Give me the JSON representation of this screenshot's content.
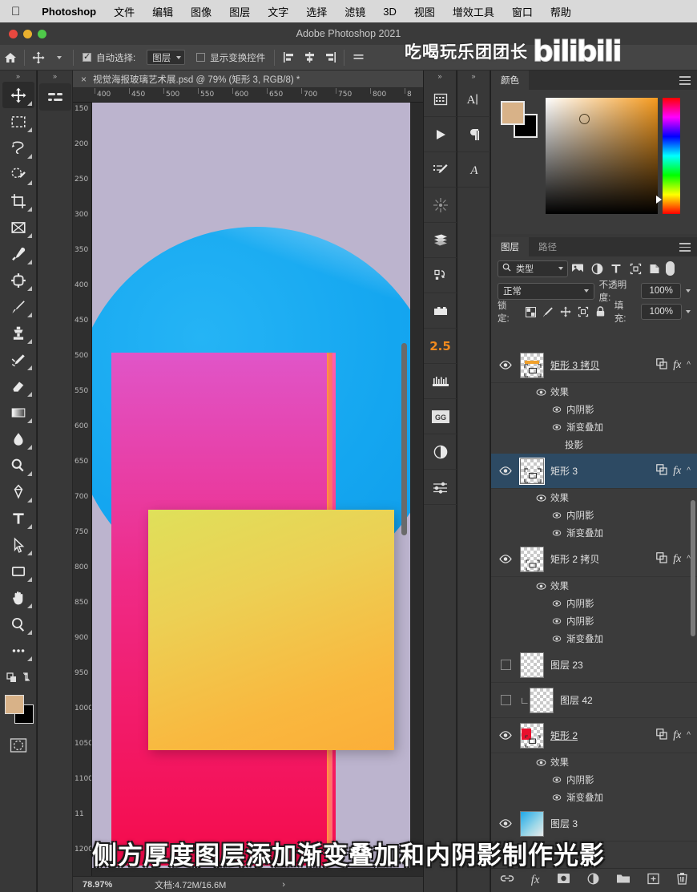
{
  "macmenu": {
    "apple_icon": "apple-icon",
    "items": [
      {
        "label": "Photoshop",
        "bold": true
      },
      {
        "label": "文件",
        "bold": false
      },
      {
        "label": "编辑",
        "bold": false
      },
      {
        "label": "图像",
        "bold": false
      },
      {
        "label": "图层",
        "bold": false
      },
      {
        "label": "文字",
        "bold": false
      },
      {
        "label": "选择",
        "bold": false
      },
      {
        "label": "滤镜",
        "bold": false
      },
      {
        "label": "3D",
        "bold": false
      },
      {
        "label": "视图",
        "bold": false
      },
      {
        "label": "增效工具",
        "bold": false
      },
      {
        "label": "窗口",
        "bold": false
      },
      {
        "label": "帮助",
        "bold": false
      }
    ]
  },
  "titlebar": {
    "title": "Adobe Photoshop 2021"
  },
  "watermark": {
    "cn": "吃喝玩乐团团长",
    "brand": "bilibili"
  },
  "options_bar": {
    "home_icon": "home-icon",
    "tool_icon": "move-tool-icon",
    "auto_select_label": "自动选择:",
    "auto_select_checked": true,
    "auto_select_value": "图层",
    "show_transform_label": "显示变换控件",
    "show_transform_checked": false,
    "align_icons": [
      "align-left-icon",
      "align-center-h-icon",
      "align-right-icon",
      "align-top-icon"
    ]
  },
  "toolbar": {
    "collapse_icon": "double-chevron-icon",
    "tools": [
      {
        "name": "move-tool",
        "selected": true
      },
      {
        "name": "rectangular-marquee-tool",
        "selected": false
      },
      {
        "name": "lasso-tool",
        "selected": false
      },
      {
        "name": "quick-selection-tool",
        "selected": false
      },
      {
        "name": "crop-tool",
        "selected": false
      },
      {
        "name": "frame-tool",
        "selected": false
      },
      {
        "name": "eyedropper-tool",
        "selected": false
      },
      {
        "name": "spot-healing-brush-tool",
        "selected": false
      },
      {
        "name": "brush-tool",
        "selected": false
      },
      {
        "name": "clone-stamp-tool",
        "selected": false
      },
      {
        "name": "history-brush-tool",
        "selected": false
      },
      {
        "name": "eraser-tool",
        "selected": false
      },
      {
        "name": "gradient-tool",
        "selected": false
      },
      {
        "name": "blur-tool",
        "selected": false
      },
      {
        "name": "dodge-tool",
        "selected": false
      },
      {
        "name": "pen-tool",
        "selected": false
      },
      {
        "name": "type-tool",
        "selected": false
      },
      {
        "name": "path-selection-tool",
        "selected": false
      },
      {
        "name": "rectangle-tool",
        "selected": false
      },
      {
        "name": "hand-tool",
        "selected": false
      },
      {
        "name": "zoom-tool",
        "selected": false
      },
      {
        "name": "edit-toolbar-tool",
        "selected": false
      }
    ],
    "foreground_color": "#d8b288",
    "background_color": "#000000",
    "quickmask_icon": "quick-mask-icon"
  },
  "second_strip": {
    "icon": "adjustments-icon"
  },
  "document": {
    "tab_close_icon": "close-icon",
    "tab_title": "视觉海报玻璃艺术展.psd @ 79% (矩形 3, RGB/8) *",
    "h_ruler_labels": [
      "400",
      "450",
      "500",
      "550",
      "600",
      "650",
      "700",
      "750",
      "800",
      "8"
    ],
    "v_ruler_labels": [
      "150",
      "200",
      "250",
      "300",
      "350",
      "400",
      "450",
      "500",
      "550",
      "600",
      "650",
      "700",
      "750",
      "800",
      "850",
      "900",
      "950",
      "1000",
      "1050",
      "1100",
      "11",
      "1200"
    ],
    "artwork": {
      "background_color": "#bcb4ce",
      "circle_color": "#14a6f0",
      "pink_panel_color": "#ef2a86",
      "pink_edge_color": "#ff7a55",
      "yellow_panel_top": "#dfe05a",
      "yellow_panel_bottom": "#fbae38"
    }
  },
  "status_bar": {
    "zoom": "78.97%",
    "doc_info": "文档:4.72M/16.6M",
    "chevron": "›"
  },
  "dock_icons": {
    "column_a": [
      {
        "name": "character-panel-icon",
        "label": ""
      },
      {
        "name": "actions-play-icon",
        "label": ""
      },
      {
        "name": "adjustments-brush-icon",
        "label": ""
      },
      {
        "name": "sparkle-icon",
        "label": ""
      },
      {
        "name": "book-icon",
        "label": ""
      },
      {
        "name": "shape-path-icon",
        "label": ""
      },
      {
        "name": "film-icon",
        "label": ""
      },
      {
        "name": "version-badge",
        "label": "2.5"
      },
      {
        "name": "crown-icon",
        "label": ""
      },
      {
        "name": "gg-plugin-icon",
        "label": "GG"
      },
      {
        "name": "contrast-circle-icon",
        "label": ""
      },
      {
        "name": "sliders-icon",
        "label": ""
      }
    ],
    "column_b": [
      {
        "name": "character-type-icon",
        "label": "A"
      },
      {
        "name": "paragraph-icon",
        "label": "¶"
      },
      {
        "name": "glyphs-icon",
        "label": ""
      }
    ]
  },
  "color_panel": {
    "tab_label": "颜色",
    "menu_icon": "panel-menu-icon",
    "foreground": "#d8b288",
    "background": "#000000"
  },
  "layers_panel": {
    "tabs": [
      {
        "label": "图层",
        "active": true
      },
      {
        "label": "路径",
        "active": false
      }
    ],
    "menu_icon": "panel-menu-icon",
    "filter": {
      "search_icon": "search-icon",
      "kind_label": "类型",
      "icons": [
        "image-filter-icon",
        "adjustment-filter-icon",
        "type-filter-icon",
        "shape-filter-icon",
        "smartobject-filter-icon"
      ],
      "toggle_icon": "filter-toggle-icon"
    },
    "blend": {
      "mode": "正常",
      "opacity_label": "不透明度:",
      "opacity_value": "100%"
    },
    "lock": {
      "label": "锁定:",
      "icons": [
        "lock-transparency-icon",
        "lock-image-icon",
        "lock-position-icon",
        "lock-artboard-icon",
        "lock-all-icon"
      ],
      "fill_label": "填充:",
      "fill_value": "100%"
    },
    "layers": [
      {
        "name": "矩形 3 拷贝",
        "visible": true,
        "selected": false,
        "underline": true,
        "link_icon": "link-icon",
        "fx_icon": "fx-icon",
        "chevron": "^",
        "thumb_type": "shape-orange",
        "effects_label": "效果",
        "effects": [
          {
            "label": "内阴影",
            "visible": true
          },
          {
            "label": "渐变叠加",
            "visible": true
          },
          {
            "label": "投影",
            "visible": false
          }
        ]
      },
      {
        "name": "矩形 3",
        "visible": true,
        "selected": true,
        "underline": false,
        "link_icon": "link-icon",
        "fx_icon": "fx-icon",
        "chevron": "^",
        "thumb_type": "shape-empty",
        "effects_label": "效果",
        "effects": [
          {
            "label": "内阴影",
            "visible": true
          },
          {
            "label": "渐变叠加",
            "visible": true
          }
        ]
      },
      {
        "name": "矩形 2 拷贝",
        "visible": true,
        "selected": false,
        "underline": false,
        "link_icon": "link-icon",
        "fx_icon": "fx-icon",
        "chevron": "^",
        "thumb_type": "shape-empty",
        "effects_label": "效果",
        "effects": [
          {
            "label": "内阴影",
            "visible": true
          },
          {
            "label": "内阴影",
            "visible": true
          },
          {
            "label": "渐变叠加",
            "visible": true
          }
        ]
      },
      {
        "name": "图层 23",
        "visible": false,
        "selected": false,
        "underline": false,
        "link_icon": "",
        "fx_icon": "",
        "chevron": "",
        "thumb_type": "empty",
        "effects_label": "",
        "effects": []
      },
      {
        "name": "图层 42",
        "visible": false,
        "selected": false,
        "underline": false,
        "link_icon": "",
        "fx_icon": "",
        "chevron": "",
        "thumb_type": "clipped",
        "effects_label": "",
        "effects": []
      },
      {
        "name": "矩形 2",
        "visible": true,
        "selected": false,
        "underline": true,
        "link_icon": "link-icon",
        "fx_icon": "fx-icon",
        "chevron": "^",
        "thumb_type": "shape-red",
        "effects_label": "效果",
        "effects": [
          {
            "label": "内阴影",
            "visible": true
          },
          {
            "label": "渐变叠加",
            "visible": true
          }
        ]
      },
      {
        "name": "图层 3",
        "visible": true,
        "selected": false,
        "underline": false,
        "link_icon": "",
        "fx_icon": "",
        "chevron": "",
        "thumb_type": "photo-blue",
        "effects_label": "",
        "effects": []
      }
    ],
    "bottom_icons": [
      {
        "name": "link-layers-icon"
      },
      {
        "name": "add-layer-style-icon"
      },
      {
        "name": "add-layer-mask-icon"
      },
      {
        "name": "new-adjustment-layer-icon"
      },
      {
        "name": "new-group-icon"
      },
      {
        "name": "new-layer-icon"
      },
      {
        "name": "delete-layer-icon"
      }
    ]
  },
  "subtitle": {
    "text": "侧方厚度图层添加渐变叠加和内阴影制作光影"
  }
}
